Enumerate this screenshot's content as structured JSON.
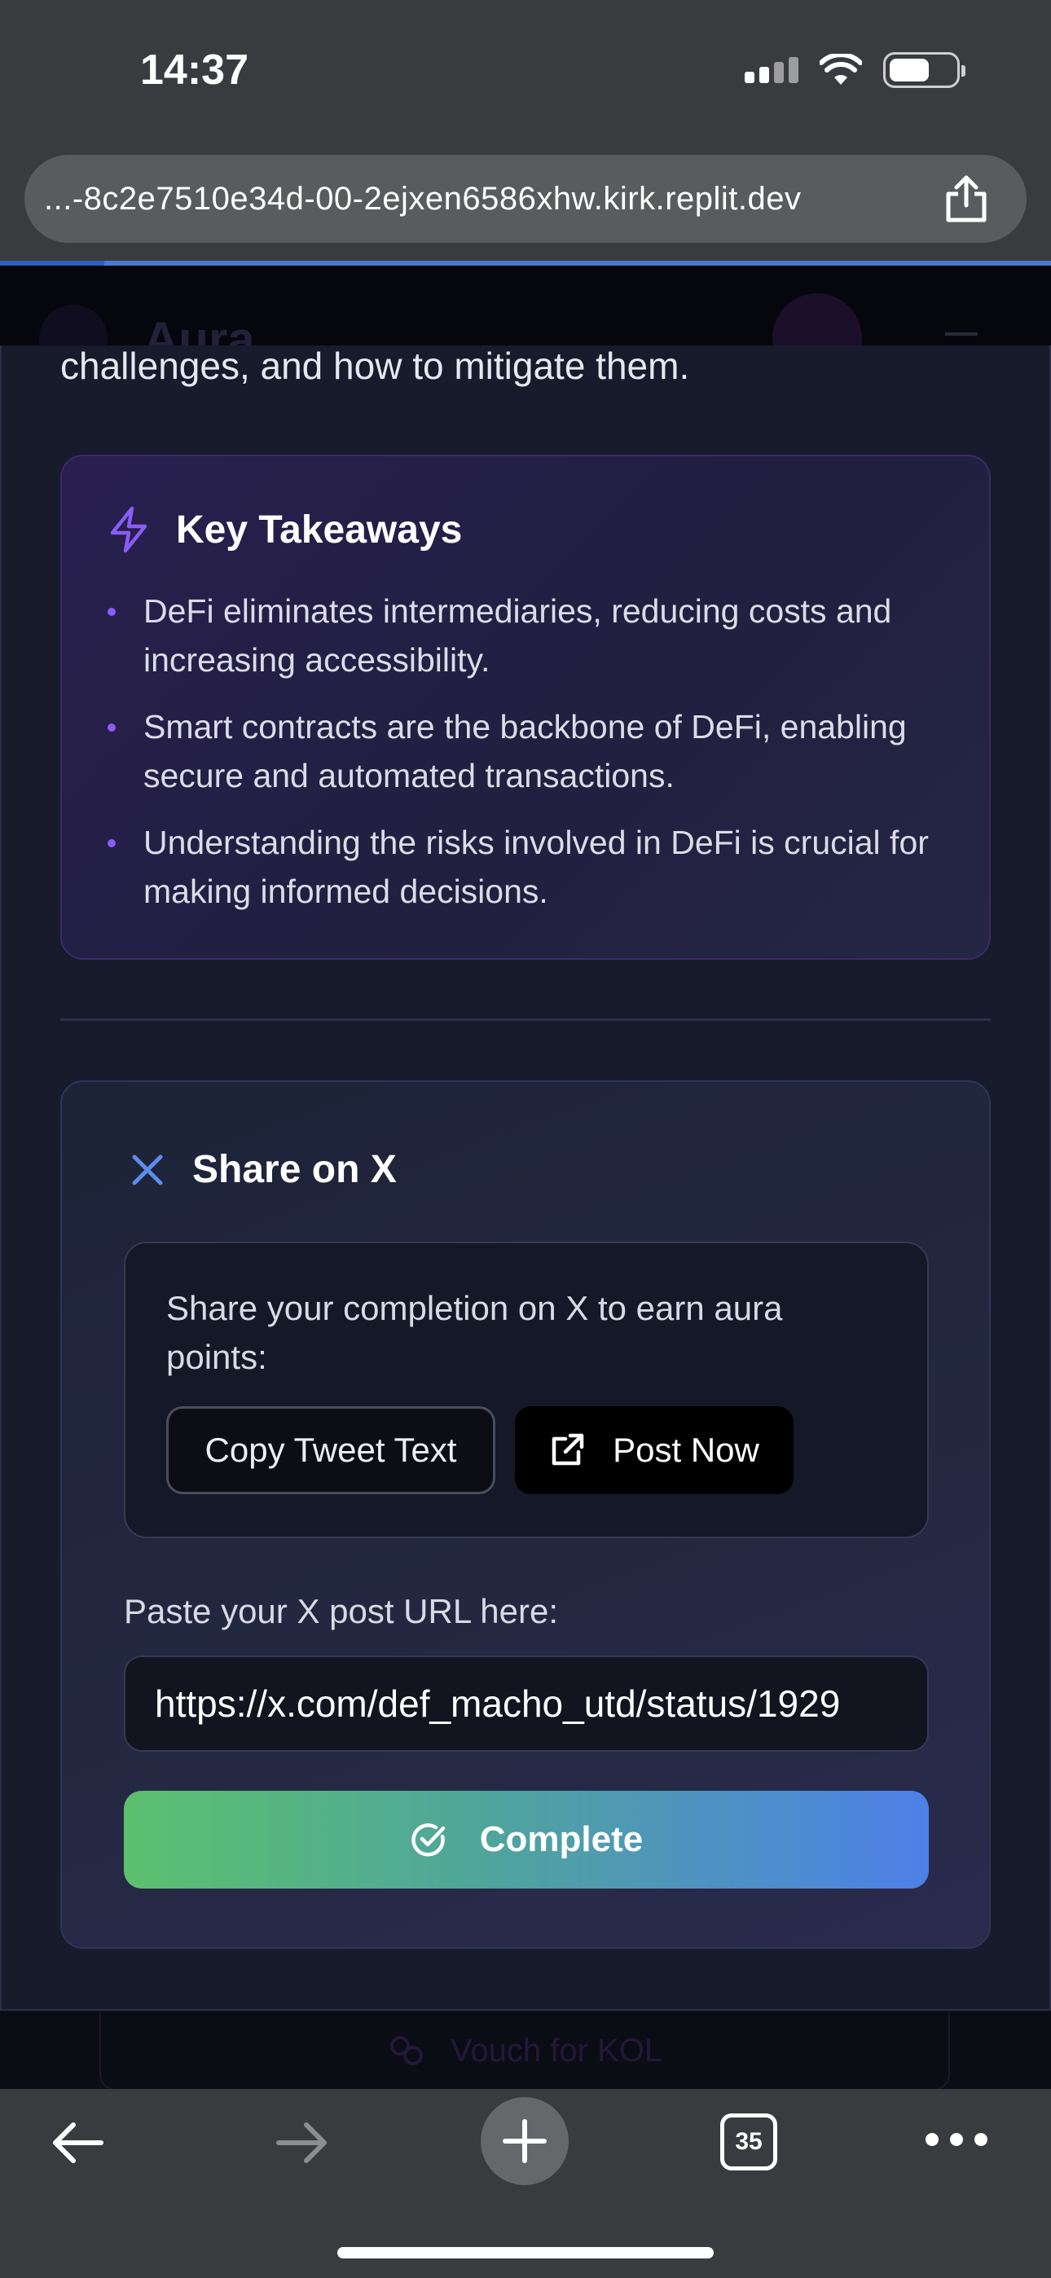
{
  "status_bar": {
    "time": "14:37"
  },
  "browser": {
    "url": "...-8c2e7510e34d-00-2ejxen6586xhw.kirk.replit.dev",
    "tab_count": "35"
  },
  "background_page": {
    "brand": "Aura",
    "vouch_label": "Vouch for KOL"
  },
  "lesson": {
    "intro_tail": "challenges, and how to mitigate them.",
    "takeaways": {
      "title": "Key Takeaways",
      "items": [
        "DeFi eliminates intermediaries, reducing costs and increasing accessibility.",
        "Smart contracts are the backbone of DeFi, enabling secure and automated transactions.",
        "Understanding the risks involved in DeFi is crucial for making informed decisions."
      ]
    }
  },
  "share": {
    "title": "Share on X",
    "description": "Share your completion on X to earn aura points:",
    "copy_label": "Copy Tweet Text",
    "post_label": "Post Now",
    "paste_label": "Paste your X post URL here:",
    "url_value": "https://x.com/def_macho_utd/status/1929",
    "complete_label": "Complete"
  },
  "colors": {
    "accent_purple": "#8a5cf6",
    "x_icon_blue": "#5b8def",
    "complete_gradient_start": "#5dc06e",
    "complete_gradient_end": "#4e80e8"
  },
  "icons": {
    "takeaways": "lightning-bolt-icon",
    "share_title": "x-close-icon",
    "post": "external-link-icon",
    "complete": "check-circle-icon"
  }
}
